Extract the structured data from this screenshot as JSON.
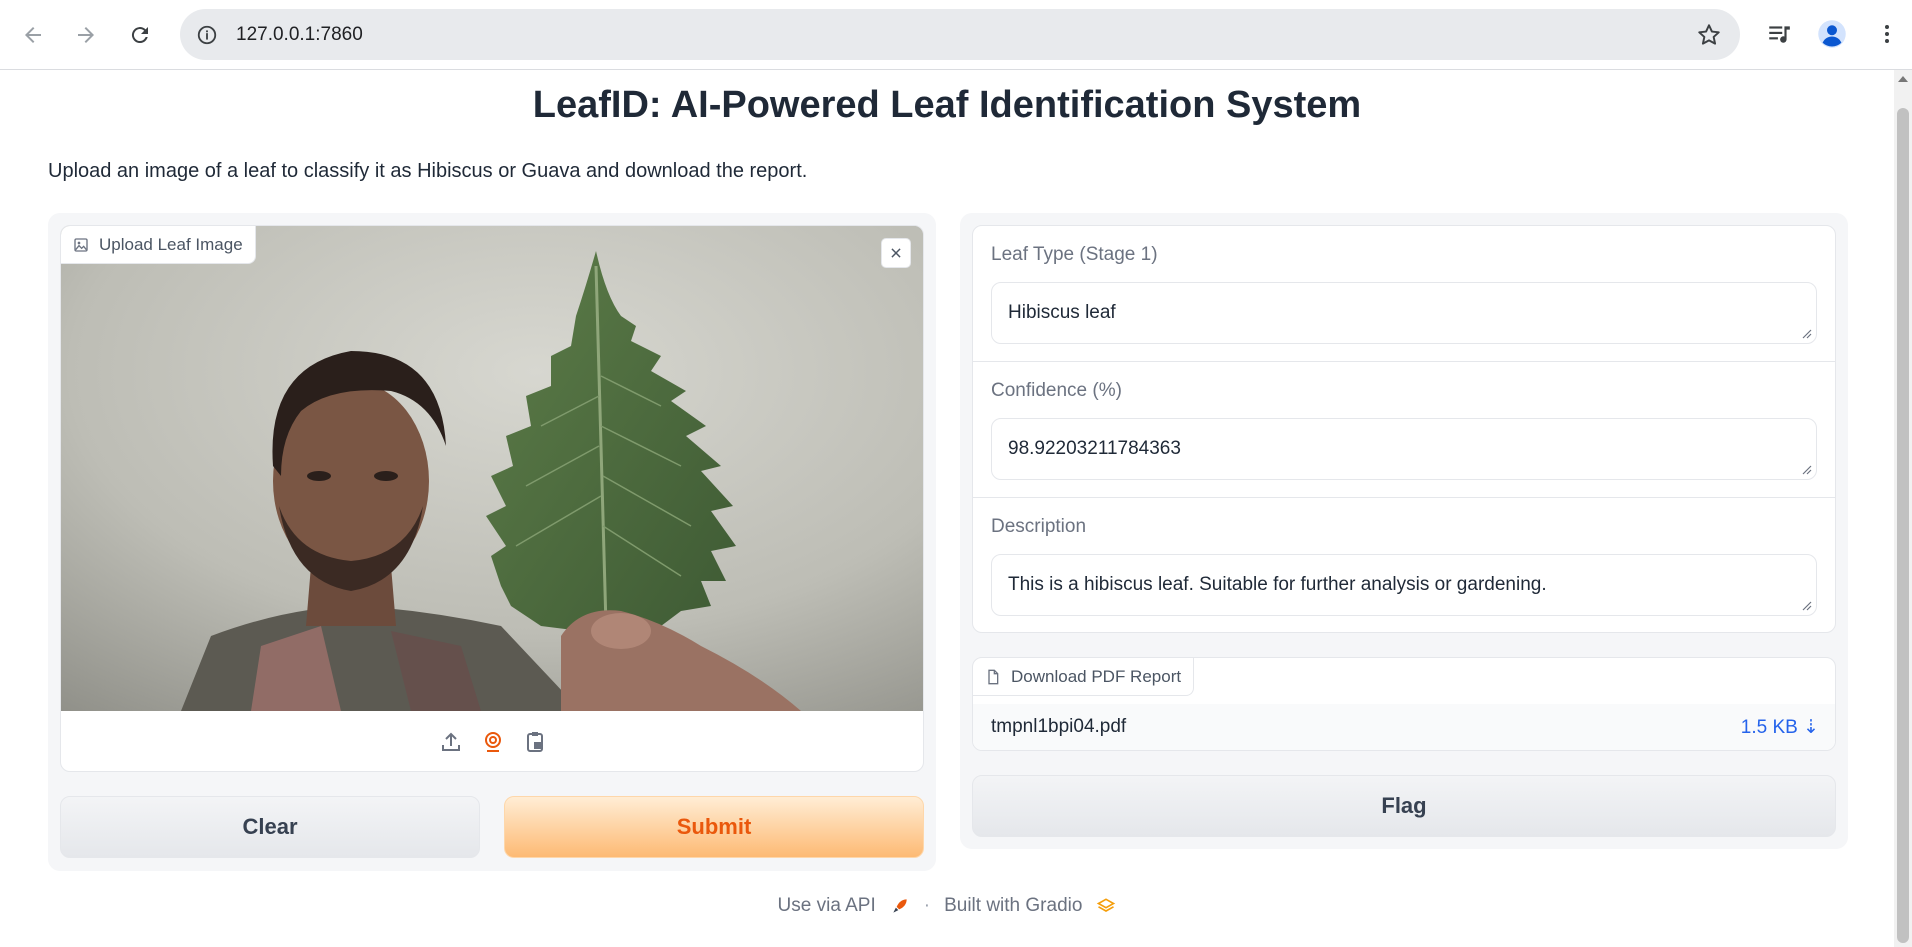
{
  "browser": {
    "url": "127.0.0.1:7860"
  },
  "page": {
    "title": "LeafID: AI-Powered Leaf Identification System",
    "description": "Upload an image of a leaf to classify it as Hibiscus or Guava and download the report."
  },
  "input": {
    "image_label": "Upload Leaf Image",
    "source_icons": [
      "upload-icon",
      "webcam-icon",
      "clipboard-icon"
    ],
    "clear_label": "Clear",
    "submit_label": "Submit"
  },
  "outputs": {
    "leaf_type": {
      "label": "Leaf Type (Stage 1)",
      "value": "Hibiscus leaf"
    },
    "confidence": {
      "label": "Confidence (%)",
      "value": "98.92203211784363"
    },
    "description": {
      "label": "Description",
      "value": "This is a hibiscus leaf. Suitable for further analysis or gardening."
    },
    "report": {
      "label": "Download PDF Report",
      "filename": "tmpnl1bpi04.pdf",
      "size": "1.5 KB ⇣"
    },
    "flag_label": "Flag"
  },
  "footer": {
    "api_text": "Use via API",
    "separator": "·",
    "built_text": "Built with Gradio"
  },
  "colors": {
    "accent": "#ea580c",
    "link": "#2563eb"
  }
}
